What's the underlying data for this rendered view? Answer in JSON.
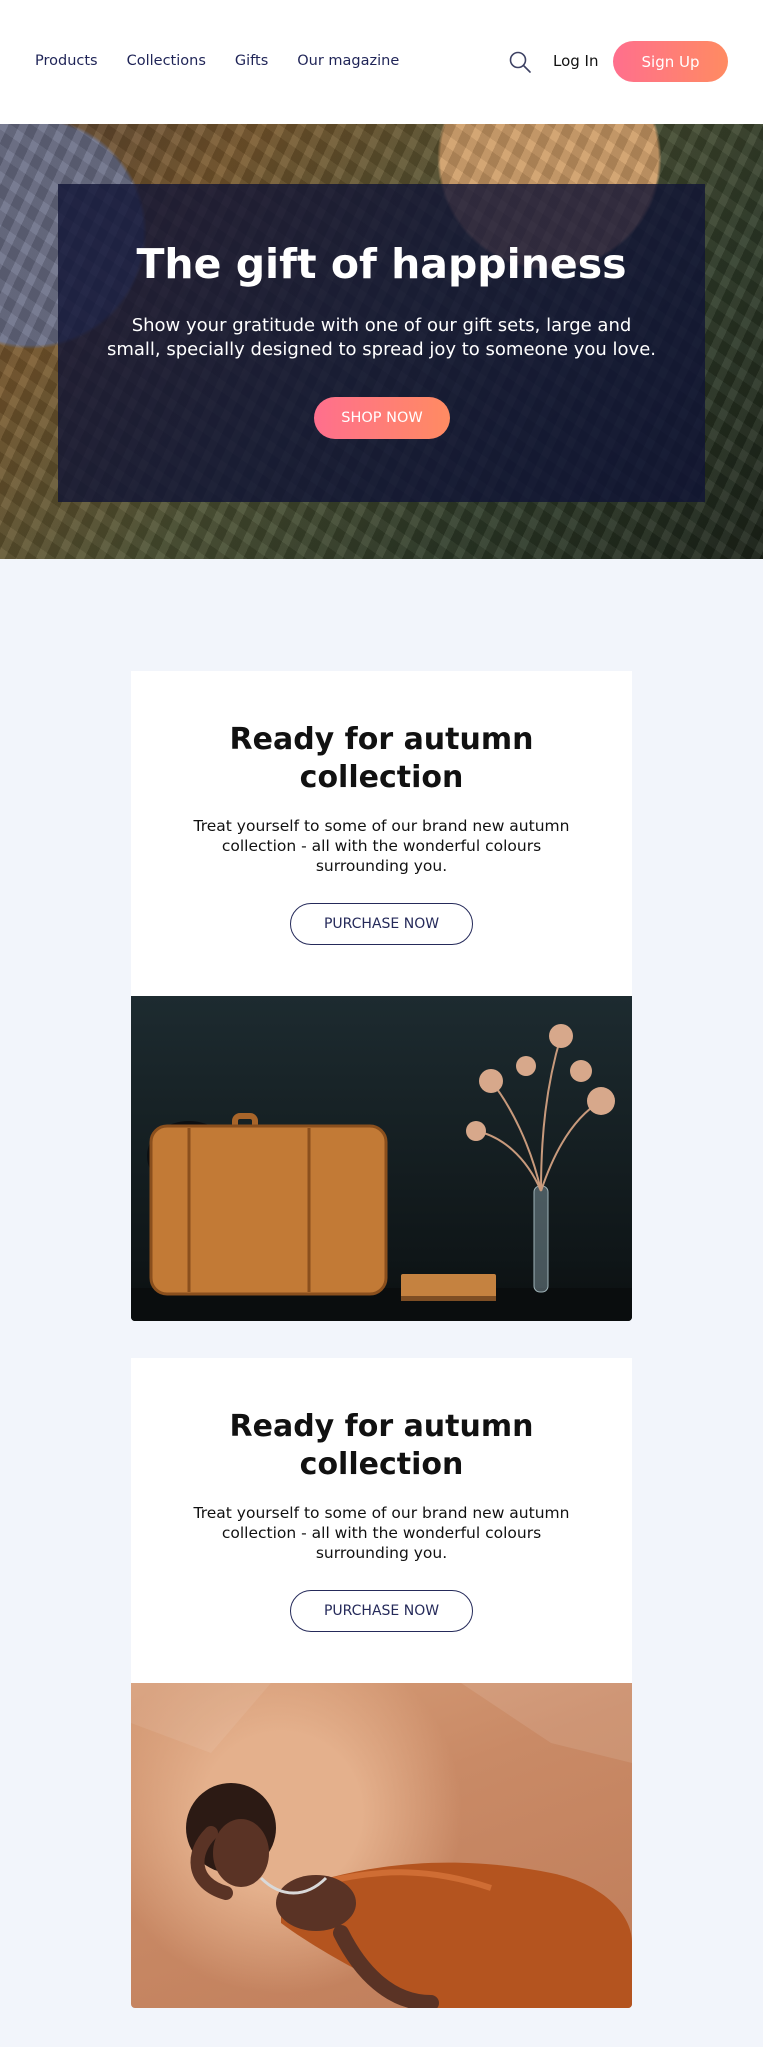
{
  "nav": {
    "items": [
      "Products",
      "Collections",
      "Gifts",
      "Our magazine"
    ],
    "login_label": "Log In",
    "signup_label": "Sign Up"
  },
  "hero": {
    "title": "The gift of happiness",
    "text": "Show your gratitude with one of our gift sets, large and small, specially designed to spread joy to someone you love.",
    "button_label": "SHOP NOW"
  },
  "cards": [
    {
      "title": "Ready for autumn collection",
      "text": "Treat yourself to some of our brand new autumn collection - all with the wonderful colours surrounding you.",
      "button_label": "PURCHASE NOW"
    },
    {
      "title": "Ready for autumn collection",
      "text": "Treat yourself to some of our brand new autumn collection - all with the wonderful colours surrounding you.",
      "button_label": "PURCHASE NOW"
    }
  ],
  "colors": {
    "accent_start": "#ff6f8d",
    "accent_end": "#ff8b62",
    "nav_text": "#1f2457",
    "page_background": "#f2f5fb"
  },
  "icons": [
    "search-icon"
  ]
}
